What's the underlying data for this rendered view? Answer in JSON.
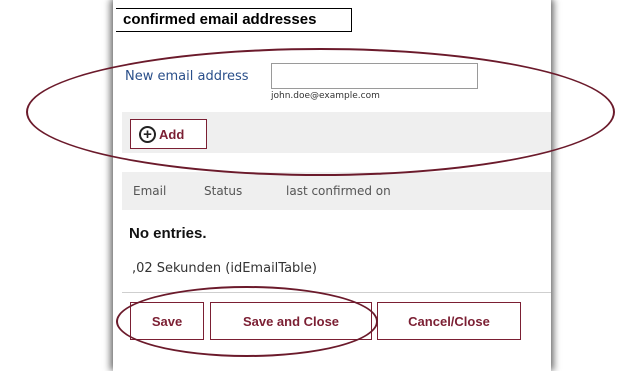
{
  "section": {
    "title": "confirmed email addresses"
  },
  "new_email": {
    "label": "New email address",
    "value": "",
    "hint": "john.doe@example.com"
  },
  "add_button": {
    "label": "Add",
    "icon": "plus-circle-icon"
  },
  "table": {
    "columns": [
      "Email",
      "Status",
      "last confirmed on"
    ],
    "empty_text": "No entries.",
    "timing_text": ",02 Sekunden (idEmailTable)"
  },
  "actions": {
    "save": "Save",
    "save_and_close": "Save and Close",
    "cancel_close": "Cancel/Close"
  },
  "colors": {
    "accent": "#7b1f33",
    "annotation": "#6b1a2b",
    "label_blue": "#2a4f8a",
    "bar_gray": "#efefef"
  }
}
